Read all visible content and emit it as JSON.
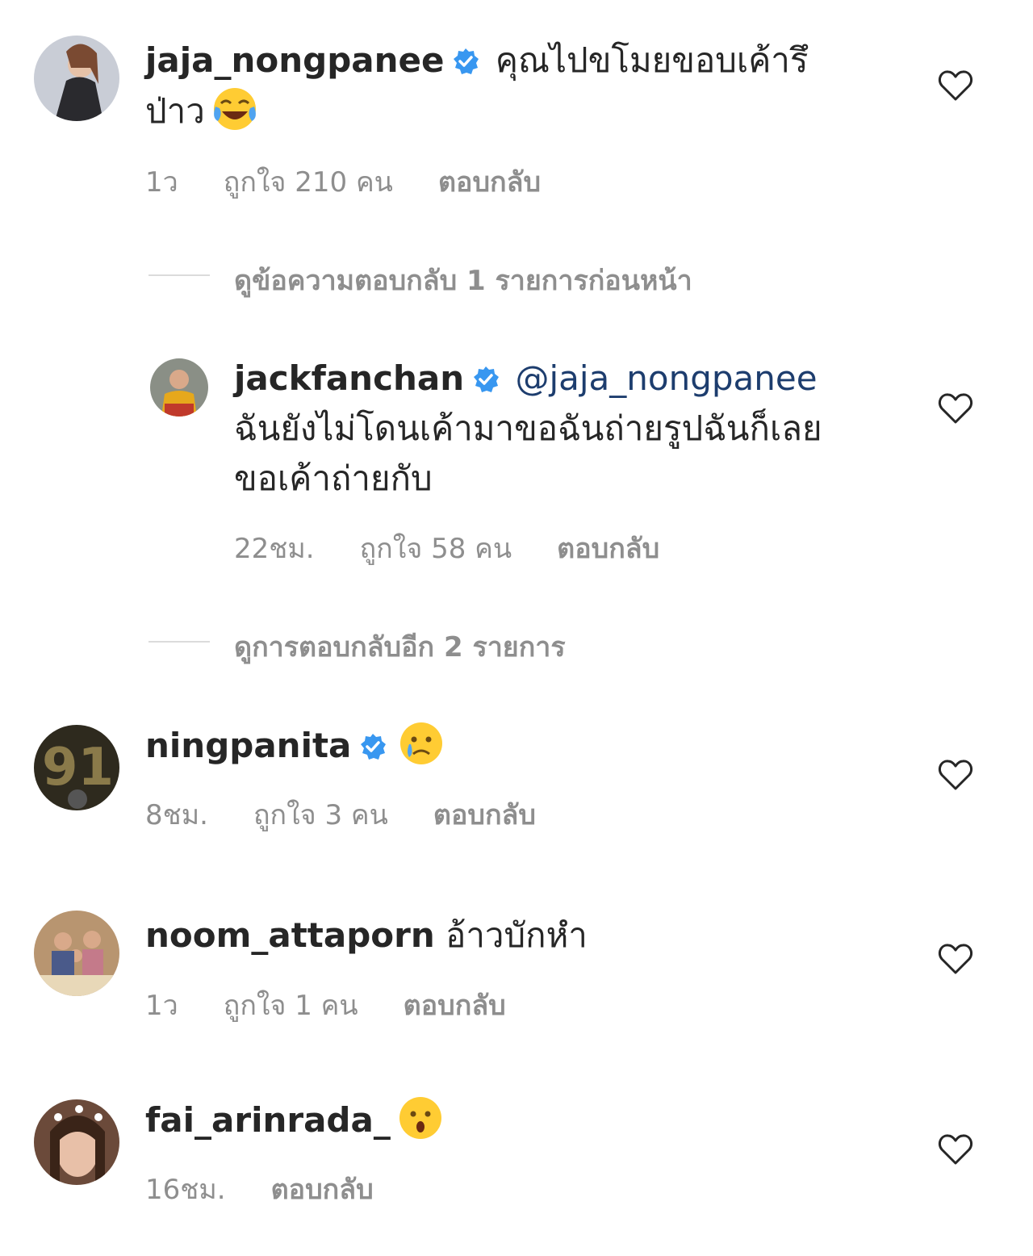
{
  "comments": [
    {
      "username": "jaja_nongpanee",
      "verified": true,
      "text": "คุณไปขโมยขอบเค้ารึ",
      "text_cont": "ป่าว",
      "emoji": "face-with-tears-of-joy",
      "time": "1ว",
      "likes": "ถูกใจ 210 คน",
      "reply": "ตอบกลับ"
    },
    {
      "username": "jackfanchan",
      "verified": true,
      "mention": "@jaja_nongpanee",
      "text_line2": "ฉันยังไม่โดนเค้ามาขอฉันถ่ายรูปฉันก็เลย",
      "text_line3": "ขอเค้าถ่ายกับ",
      "time": "22ชม.",
      "likes": "ถูกใจ 58 คน",
      "reply": "ตอบกลับ"
    },
    {
      "username": "ningpanita",
      "verified": true,
      "emoji": "crying-face",
      "time": "8ชม.",
      "likes": "ถูกใจ 3 คน",
      "reply": "ตอบกลับ"
    },
    {
      "username": "noom_attaporn",
      "verified": false,
      "text": "อ้าวบักหำ",
      "time": "1ว",
      "likes": "ถูกใจ 1 คน",
      "reply": "ตอบกลับ"
    },
    {
      "username": "fai_arinrada_",
      "verified": false,
      "emoji": "hushed-face",
      "time": "16ชม.",
      "reply": "ตอบกลับ"
    }
  ],
  "view_previous_replies": "ดูข้อความตอบกลับ 1 รายการก่อนหน้า",
  "view_more_replies": "ดูการตอบกลับอีก 2 รายการ",
  "colors": {
    "verified": "#3897f0",
    "meta": "#8e8e8e",
    "mention": "#1d3d6e"
  }
}
